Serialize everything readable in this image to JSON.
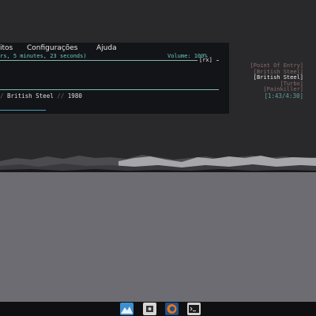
{
  "menu": {
    "items": [
      "itos",
      "Configurações",
      "Ajuda"
    ]
  },
  "status": {
    "elapsed": "rs, 5 minutes, 23 seconds)",
    "volume": "Volume: 100%",
    "rx": "[rx]"
  },
  "playlist": [
    {
      "title": "[Point Of Entry]",
      "current": false
    },
    {
      "title": "[British Steel]",
      "current": false
    },
    {
      "title": "[British Steel]",
      "current": true
    },
    {
      "title": "[Turbo]",
      "current": false
    },
    {
      "title": "[Painkiller]",
      "current": false
    }
  ],
  "now_playing": {
    "album": "British Steel",
    "year": "1980",
    "time": "[1:43/4:30]",
    "progress": 0.15
  },
  "colors": {
    "desktop_top": "#29292b",
    "desktop_bottom": "#6c6c72",
    "terminal_bg": "#121417",
    "accent": "#6ec7c2"
  },
  "taskbar": {
    "icons": [
      "mountain-icon",
      "cpu-icon",
      "fox-icon",
      "terminal-icon"
    ]
  }
}
